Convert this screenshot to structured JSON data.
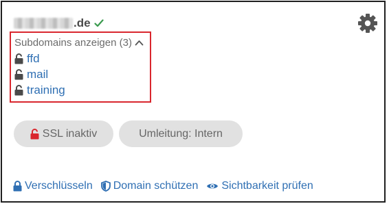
{
  "domain": {
    "tld": ".de",
    "verified_icon": "check-icon"
  },
  "settings": {
    "icon": "gear-icon"
  },
  "subdomains": {
    "toggle_label": "Subdomains anzeigen (3)",
    "toggle_icon": "chevron-up-icon",
    "items": [
      {
        "name": "ffd",
        "icon": "lock-open-icon"
      },
      {
        "name": "mail",
        "icon": "lock-open-icon"
      },
      {
        "name": "training",
        "icon": "lock-open-icon"
      }
    ]
  },
  "status": {
    "ssl_label": "SSL inaktiv",
    "ssl_icon": "lock-open-icon",
    "redirect_label": "Umleitung: Intern"
  },
  "actions": {
    "encrypt_label": "Verschlüsseln",
    "protect_label": "Domain schützen",
    "visibility_label": "Sichtbarkeit prüfen"
  },
  "colors": {
    "link": "#2f6fb3",
    "check": "#3a9a4e",
    "danger": "#d9262d",
    "pill_bg": "#e1e1e1",
    "icon_gray": "#555555",
    "lock_dark": "#4a4a4a"
  }
}
